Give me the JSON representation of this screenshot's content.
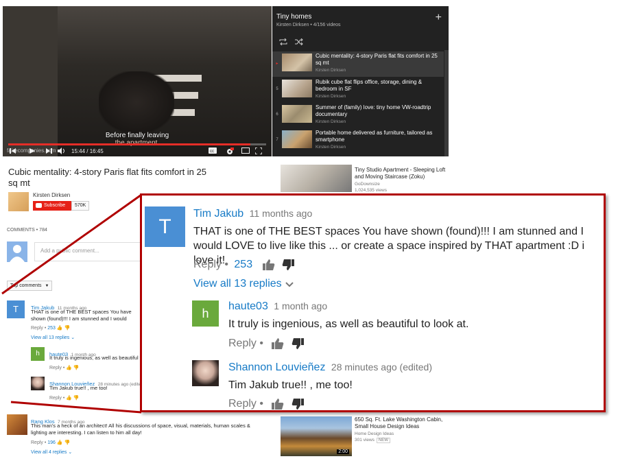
{
  "player": {
    "caption_line1": "Before finally leaving",
    "caption_line2": "the apartment.",
    "watermark": "fairecompanies.com",
    "time": "15:44 / 16:45",
    "progress": 0.94
  },
  "playlist": {
    "title": "Tiny homes",
    "meta": "Kirsten Dirksen • 4/156 videos",
    "items": [
      {
        "num": "▸",
        "title": "Cubic mentality: 4-story Paris flat fits comfort in 25 sq mt",
        "channel": "Kirsten Dirksen",
        "active": true
      },
      {
        "num": "5",
        "title": "Rubik cube flat flips office, storage, dining & bedroom in SF",
        "channel": "Kirsten Dirksen"
      },
      {
        "num": "6",
        "title": "Summer of (family) love: tiny home VW-roadtrip documentary",
        "channel": "Kirsten Dirksen"
      },
      {
        "num": "7",
        "title": "Portable home delivered as furniture, tailored as smartphone",
        "channel": "Kirsten Dirksen"
      }
    ]
  },
  "video": {
    "title": "Cubic mentality: 4-story Paris flat fits comfort in 25 sq mt",
    "channel": "Kirsten Dirksen",
    "subscribe": "Subscribe",
    "subscribers": "570K"
  },
  "comments": {
    "header": "COMMENTS • 784",
    "placeholder": "Add a public comment...",
    "sort": "Top comments",
    "list": [
      {
        "author": "Tim Jakub",
        "time": "11 months ago",
        "text": "THAT is one of THE BEST spaces You have shown (found)!!! I am stunned and I would LOVE to live like this ... or create a space inspired by THAT apartment :D i love it!",
        "reply": "Reply",
        "likes": "253",
        "view_replies": "View all 13 replies"
      },
      {
        "author": "haute03",
        "time": "1 month ago",
        "text": "It truly is ingenious, as well as beautiful to look at.",
        "reply": "Reply"
      },
      {
        "author": "Shannon Louvieñez",
        "time": "28 minutes ago (edited)",
        "text": "Tim Jakub  true!! , me too!",
        "reply": "Reply"
      },
      {
        "author": "Rang Klos",
        "time": "7 months ago",
        "text": "This man's a heck of an architect! All his discussions of space, visual, materials, human scales & lighting are interesting. I can listen to him all day!",
        "reply": "Reply",
        "likes": "196",
        "view_replies": "View all 4 replies"
      }
    ]
  },
  "related": [
    {
      "title": "Tiny Studio Apartment - Sleeping Loft and Moving Staircase (Zoku)",
      "channel": "GoDownsize",
      "views": "1,024,535 views"
    },
    {
      "title": "650 Sq. Ft. Lake Washington Cabin, Small House Design Ideas",
      "channel": "Home Design Ideas",
      "views": "301 views",
      "badge": "NEW",
      "duration": "2:00"
    }
  ],
  "colors": {
    "accent": "#e62117",
    "link": "#167ac6",
    "callout_border": "#b00000"
  }
}
